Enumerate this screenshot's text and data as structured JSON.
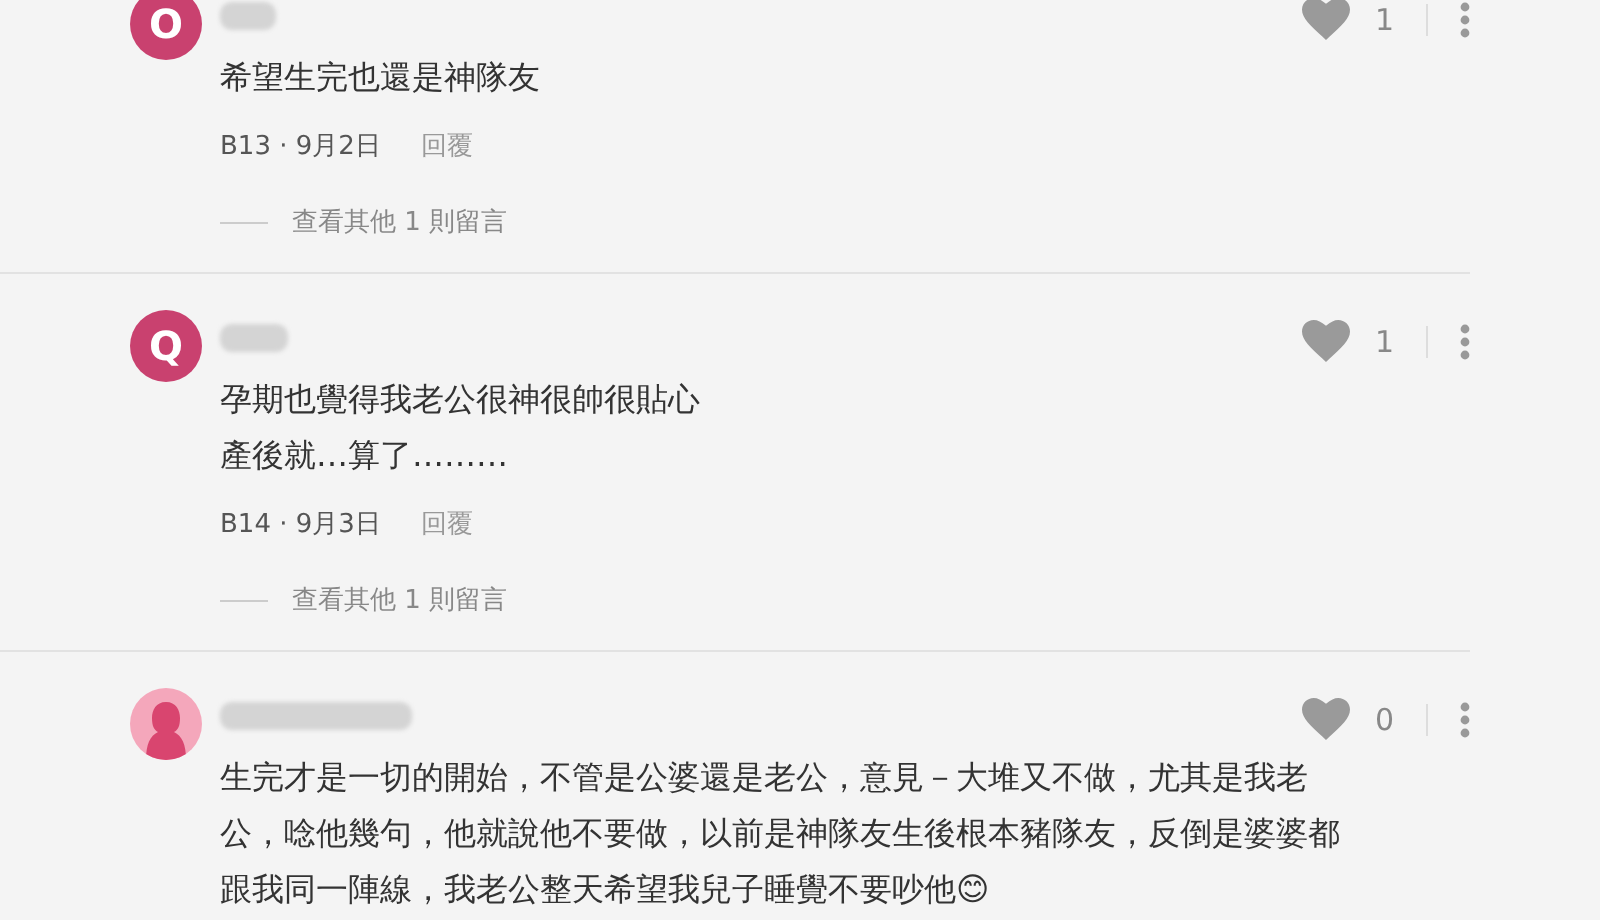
{
  "comments": [
    {
      "avatar": {
        "kind": "letter",
        "letter": "O",
        "color": "#c9416f"
      },
      "likes": "1",
      "lines": [
        "希望生完也還是神隊友"
      ],
      "meta": "B13 · 9月2日",
      "reply": "回覆",
      "view_more": "查看其他 1 則留言"
    },
    {
      "avatar": {
        "kind": "letter",
        "letter": "Q",
        "color": "#c9416f"
      },
      "likes": "1",
      "lines": [
        "孕期也覺得我老公很神很帥很貼心",
        "產後就…算了………"
      ],
      "meta": "B14 · 9月3日",
      "reply": "回覆",
      "view_more": "查看其他 1 則留言"
    },
    {
      "avatar": {
        "kind": "silhouette",
        "color": "#f4a7bb"
      },
      "likes": "0",
      "lines": [
        "生完才是一切的開始，不管是公婆還是老公，意見－大堆又不做，尤其是我老公，唸他幾句，他就說他不要做，以前是神隊友生後根本豬隊友，反倒是婆婆都跟我同一陣線，我老公整天希望我兒子睡覺不要吵他😊"
      ]
    }
  ]
}
